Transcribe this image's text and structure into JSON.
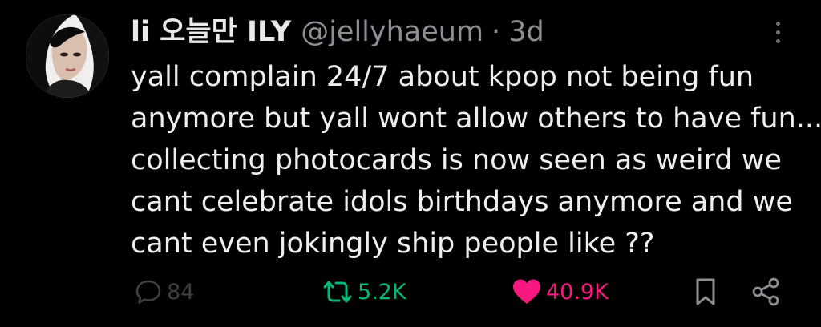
{
  "tweet": {
    "display_name": "li 오늘만 ILY",
    "handle": "@jellyhaeum",
    "separator": "·",
    "time": "3d",
    "body_lines": [
      "yall complain 24/7 about kpop not being fun",
      "anymore but yall wont allow others to have fun...",
      "collecting photocards is now seen as weird we",
      "cant celebrate idols birthdays anymore and we",
      "cant even jokingly ship people like ??"
    ]
  },
  "actions": {
    "replies": "84",
    "retweets": "5.2K",
    "likes": "40.9K"
  },
  "colors": {
    "background": "#000000",
    "text": "#e7e9ea",
    "muted": "#8b8f94",
    "retweet_green": "#00ba7c",
    "like_pink": "#f91880",
    "reply_dim": "#3b3f44"
  },
  "icons": {
    "reply": "speech-bubble-icon",
    "retweet": "retweet-arrows-icon",
    "like": "heart-icon",
    "bookmark": "bookmark-icon",
    "share": "share-nodes-icon",
    "more": "vertical-dots-icon"
  }
}
